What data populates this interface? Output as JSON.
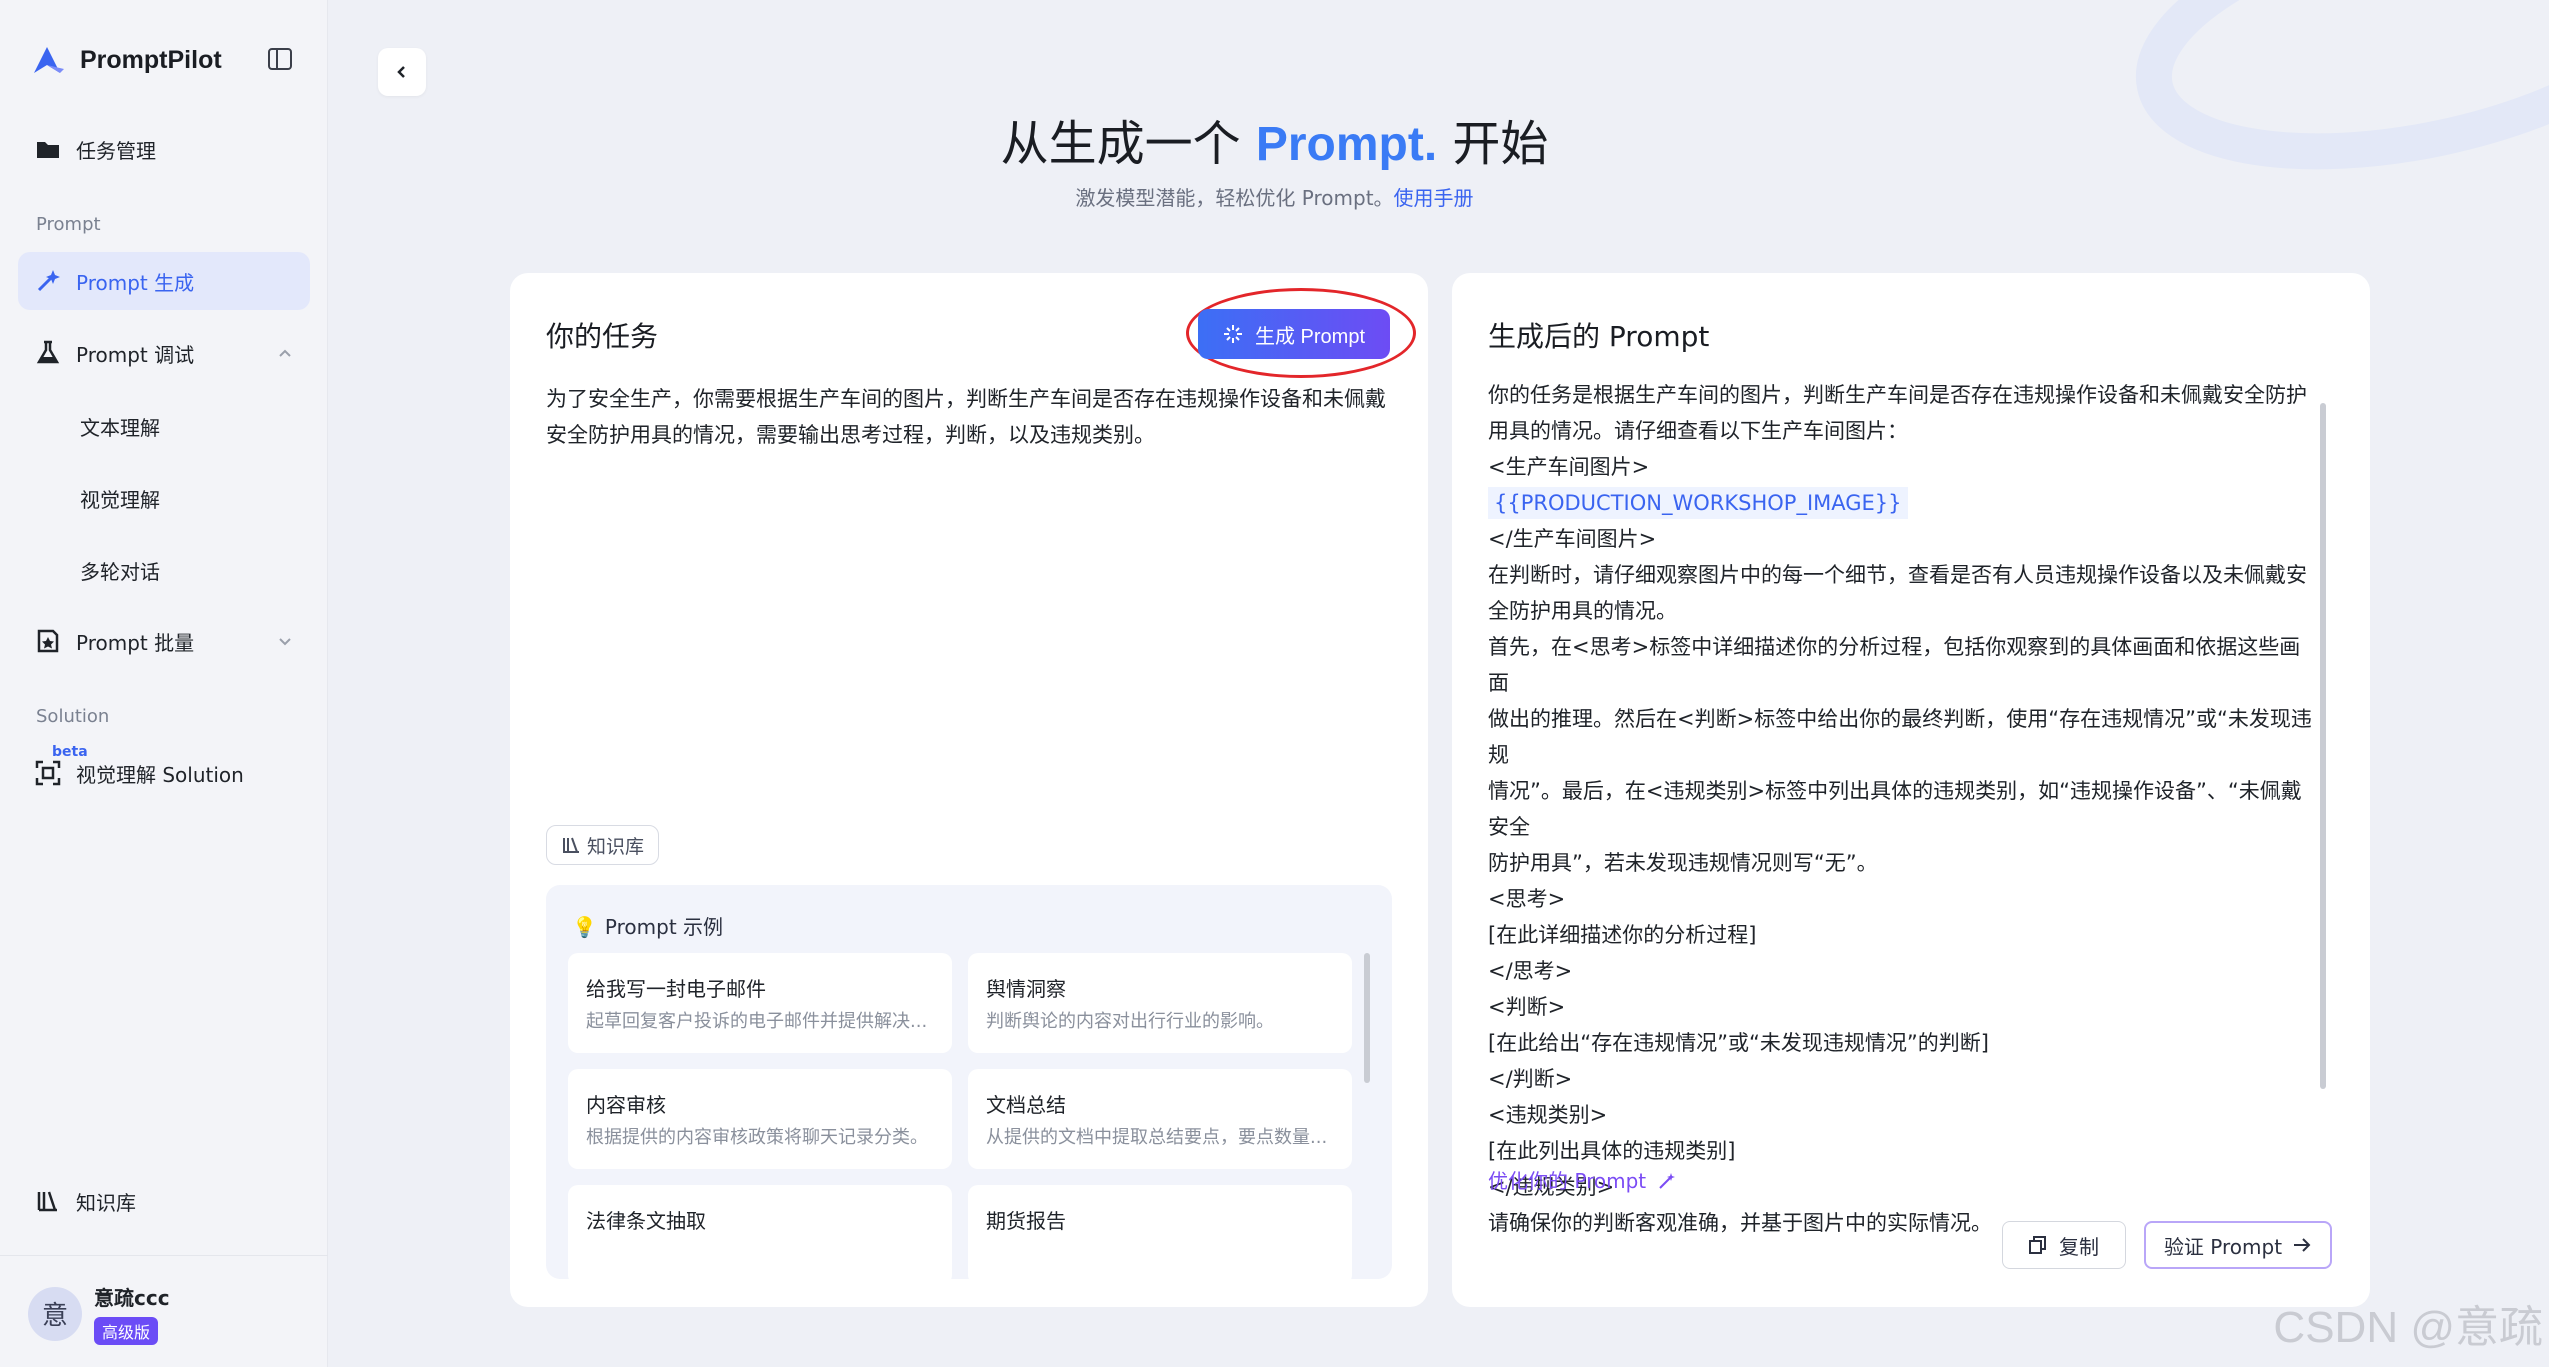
{
  "app": {
    "name": "PromptPilot"
  },
  "sidebar": {
    "task_mgmt": "任务管理",
    "section_prompt": "Prompt",
    "prompt_gen": "Prompt 生成",
    "prompt_debug": "Prompt 调试",
    "sub_items": [
      "文本理解",
      "视觉理解",
      "多轮对话"
    ],
    "prompt_batch": "Prompt 批量",
    "section_solution": "Solution",
    "beta": "beta",
    "visual_solution": "视觉理解 Solution",
    "knowledge": "知识库",
    "user": {
      "avatar": "意",
      "name": "意疏ccc",
      "plan": "高级版"
    }
  },
  "hero": {
    "title_pre": "从生成一个 ",
    "title_hl": "Prompt.",
    "title_post": " 开始",
    "subtitle": "激发模型潜能，轻松优化 Prompt。",
    "manual_link": "使用手册"
  },
  "task_card": {
    "title": "你的任务",
    "generate_label": "生成 Prompt",
    "task_text": "为了安全生产，你需要根据生产车间的图片，判断生产车间是否存在违规操作设备和未佩戴安全防护用具的情况，需要输出思考过程，判断，以及违规类别。",
    "knowledge_chip": "知识库",
    "examples_title": "Prompt 示例",
    "examples": [
      {
        "title": "给我写一封电子邮件",
        "desc": "起草回复客户投诉的电子邮件并提供解决..."
      },
      {
        "title": "舆情洞察",
        "desc": "判断舆论的内容对出行行业的影响。"
      },
      {
        "title": "内容审核",
        "desc": "根据提供的内容审核政策将聊天记录分类。"
      },
      {
        "title": "文档总结",
        "desc": "从提供的文档中提取总结要点，要点数量..."
      },
      {
        "title": "法律条文抽取",
        "desc": ""
      },
      {
        "title": "期货报告",
        "desc": ""
      }
    ]
  },
  "result_card": {
    "title": "生成后的 Prompt",
    "lines": [
      "你的任务是根据生产车间的图片，判断生产车间是否存在违规操作设备和未佩戴安全防护",
      "用具的情况。请仔细查看以下生产车间图片：",
      "<生产车间图片>",
      "{{PRODUCTION_WORKSHOP_IMAGE}}",
      "</生产车间图片>",
      "在判断时，请仔细观察图片中的每一个细节，查看是否有人员违规操作设备以及未佩戴安",
      "全防护用具的情况。",
      "首先，在<思考>标签中详细描述你的分析过程，包括你观察到的具体画面和依据这些画面",
      "做出的推理。然后在<判断>标签中给出你的最终判断，使用“存在违规情况”或“未发现违规",
      "情况”。最后，在<违规类别>标签中列出具体的违规类别，如“违规操作设备”、“未佩戴安全",
      "防护用具”，若未发现违规情况则写“无”。",
      "<思考>",
      "[在此详细描述你的分析过程]",
      "</思考>",
      "<判断>",
      "[在此给出“存在违规情况”或“未发现违规情况”的判断]",
      "</判断>",
      "<违规类别>",
      "[在此列出具体的违规类别]",
      "</违规类别>",
      "请确保你的判断客观准确，并基于图片中的实际情况。"
    ],
    "optimize_label": "优化你的 Prompt",
    "copy_label": "复制",
    "verify_label": "验证 Prompt"
  },
  "watermark": "CSDN @意疏",
  "colors": {
    "accent": "#3a64f0",
    "gradient_start": "#3c6ff5",
    "gradient_end": "#6d4cf4",
    "annotation_red": "#e3262a"
  }
}
